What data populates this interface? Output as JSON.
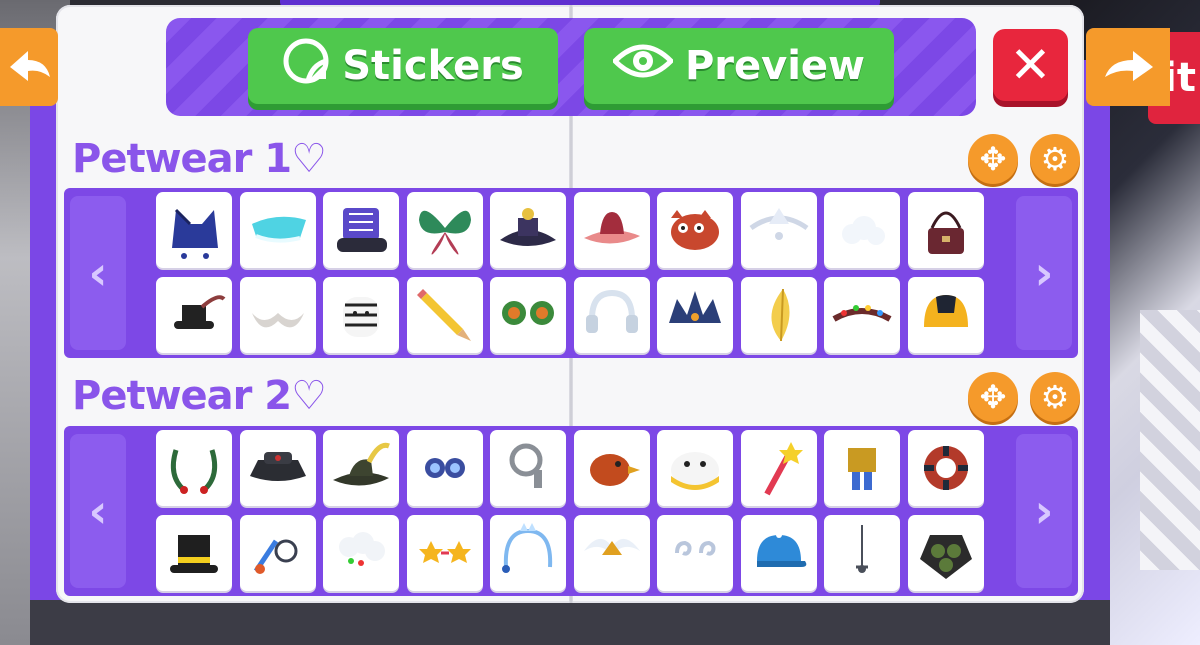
{
  "header": {
    "stickers_label": "Stickers",
    "preview_label": "Preview",
    "close_label": "✕",
    "side_exit_text": "it"
  },
  "sections": [
    {
      "title": "Petwear 1♡",
      "items": [
        "blue-cat-ears-hat",
        "cyan-visor",
        "purple-boots",
        "green-butterfly-wings",
        "dark-pagoda-hat",
        "pink-cowboy-hat",
        "red-panda-plush",
        "silver-tiara",
        "white-cloud",
        "brown-satchel",
        "feather-top-hat",
        "white-mustache",
        "zebra-plush",
        "yellow-pencil",
        "leaf-ear-wreath",
        "white-headphones",
        "dark-crystal-crown",
        "golden-feather",
        "christmas-lights-crown",
        "yellow-black-cap"
      ]
    },
    {
      "title": "Petwear 2♡",
      "items": [
        "holly-scarf",
        "black-bucket-hat",
        "feather-musketeer-hat",
        "blue-goggles",
        "grey-hook",
        "kiwi-bird-hat",
        "penguin-visor-hat",
        "star-sword",
        "golden-crown-legs",
        "striped-swim-ring",
        "yellow-band-top-hat",
        "blue-dragonfly-toy",
        "white-blossom-wreath",
        "star-glasses",
        "icicle-headband",
        "winged-tiara",
        "swirl-clouds",
        "blue-baseball-cap",
        "rapier-sword",
        "green-triple-speakers"
      ]
    }
  ],
  "colors": {
    "accent_purple": "#7d48e6",
    "button_green": "#4fc84d",
    "close_red": "#e8263d",
    "orange": "#f59a2b"
  }
}
